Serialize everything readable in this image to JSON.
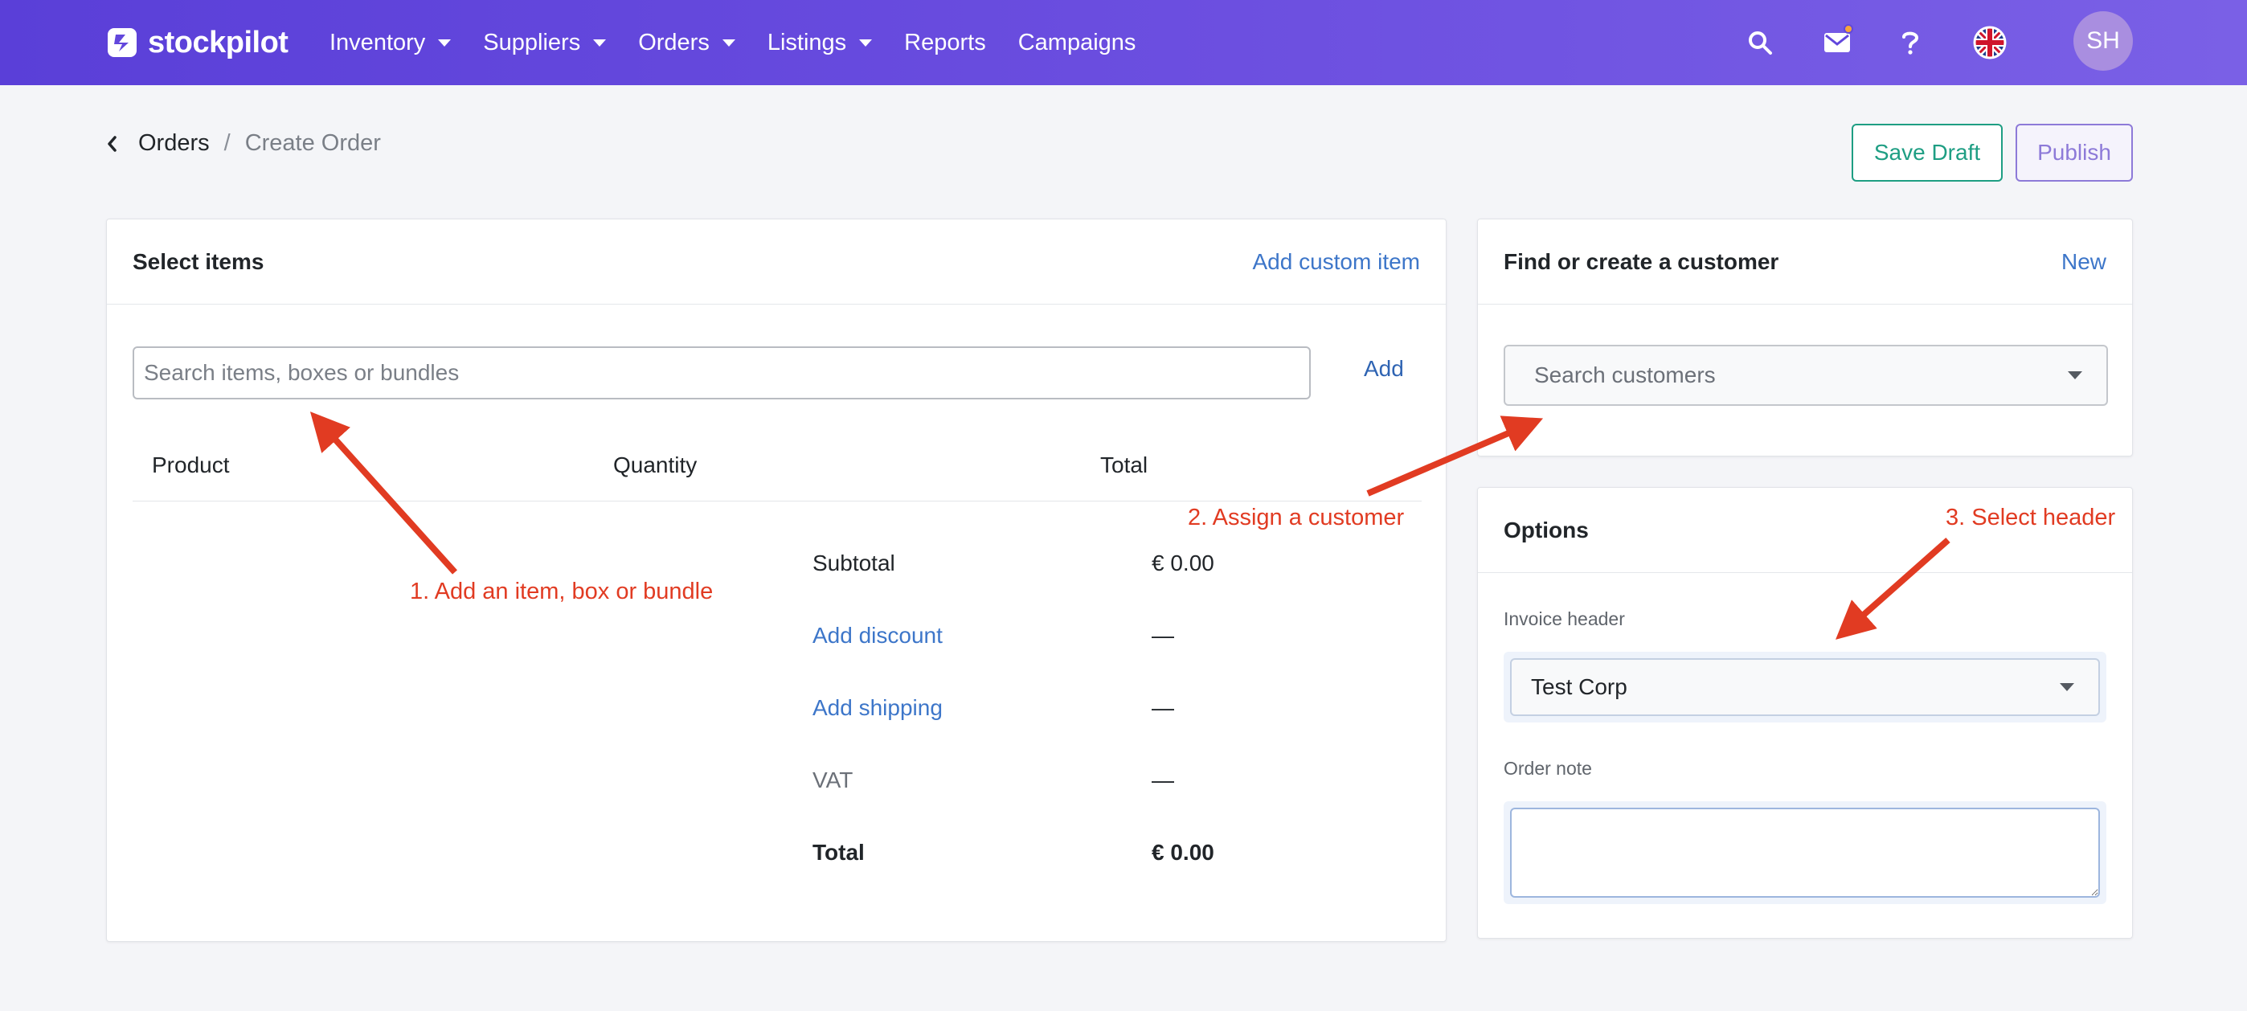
{
  "brand": {
    "name": "stockpilot"
  },
  "nav": {
    "items": [
      {
        "label": "Inventory",
        "dropdown": true
      },
      {
        "label": "Suppliers",
        "dropdown": true
      },
      {
        "label": "Orders",
        "dropdown": true
      },
      {
        "label": "Listings",
        "dropdown": true
      },
      {
        "label": "Reports",
        "dropdown": false
      },
      {
        "label": "Campaigns",
        "dropdown": false
      }
    ],
    "icons": [
      "search-icon",
      "mail-icon",
      "help-icon",
      "uk-flag-icon"
    ],
    "avatar_initials": "SH"
  },
  "breadcrumb": {
    "parent": "Orders",
    "separator": "/",
    "current": "Create Order"
  },
  "actions": {
    "save_draft": "Save Draft",
    "publish": "Publish"
  },
  "items_card": {
    "title": "Select items",
    "custom_link": "Add custom item",
    "search_placeholder": "Search items, boxes or bundles",
    "add_label": "Add",
    "columns": {
      "product": "Product",
      "quantity": "Quantity",
      "total": "Total"
    },
    "summary": {
      "subtotal_label": "Subtotal",
      "subtotal_value": "€ 0.00",
      "discount_label": "Add discount",
      "discount_value": "—",
      "shipping_label": "Add shipping",
      "shipping_value": "—",
      "vat_label": "VAT",
      "vat_value": "—",
      "total_label": "Total",
      "total_value": "€ 0.00"
    }
  },
  "customer_card": {
    "title": "Find or create a customer",
    "new_link": "New",
    "search_placeholder": "Search customers"
  },
  "options_card": {
    "title": "Options",
    "invoice_header_label": "Invoice header",
    "invoice_header_value": "Test Corp",
    "order_note_label": "Order note",
    "order_note_value": ""
  },
  "annotations": {
    "step1": "1. Add an item, box or bundle",
    "step2": "2. Assign a customer",
    "step3": "3. Select header",
    "color": "#e13b22"
  },
  "colors": {
    "nav_gradient_start": "#5a3fd8",
    "nav_gradient_end": "#7a60e6",
    "draft_button": "#1e9e83",
    "publish_button": "#8d7ad8",
    "link": "#3d76c9",
    "avatar_bg": "#a98ee0",
    "notification_dot": "#f7a53b"
  }
}
